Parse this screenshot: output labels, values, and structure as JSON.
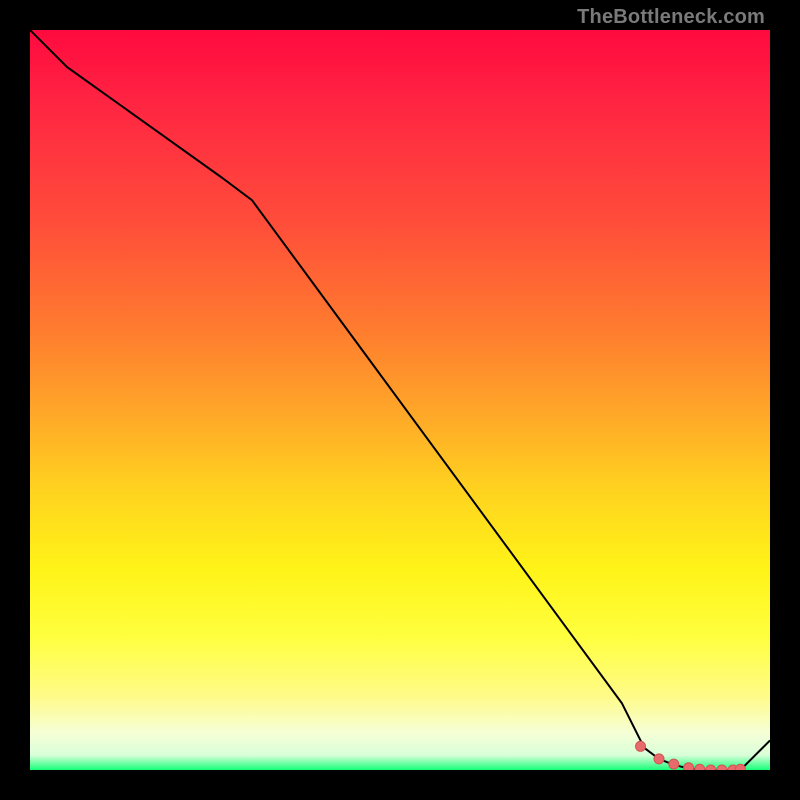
{
  "watermark": {
    "text": "TheBottleneck.com"
  },
  "colors": {
    "background": "#000000",
    "line": "#000000",
    "marker_fill": "#e86a6a",
    "marker_stroke": "#d05555",
    "gradient_top": "#ff0a3f",
    "gradient_bottom": "#16ff7a"
  },
  "chart_data": {
    "type": "line",
    "title": "",
    "xlabel": "",
    "ylabel": "",
    "xlim": [
      0,
      100
    ],
    "ylim": [
      0,
      100
    ],
    "grid": false,
    "legend": false,
    "series": [
      {
        "name": "bottleneck-curve",
        "x": [
          0,
          5,
          26,
          30,
          80,
          83,
          85,
          87,
          89,
          91,
          93,
          95,
          96,
          100
        ],
        "values": [
          100,
          95,
          80,
          77,
          9,
          3,
          1.5,
          0.7,
          0.2,
          0,
          0,
          0,
          0,
          4
        ],
        "_note": "y is percent-height measured from bottom of plot; x is percent-width from left"
      }
    ],
    "markers": {
      "name": "marker-dots",
      "x": [
        82.5,
        85,
        87,
        89,
        90.5,
        92,
        93.5,
        95,
        96
      ],
      "values": [
        3.2,
        1.5,
        0.8,
        0.3,
        0.1,
        0,
        0,
        0,
        0.1
      ]
    }
  }
}
